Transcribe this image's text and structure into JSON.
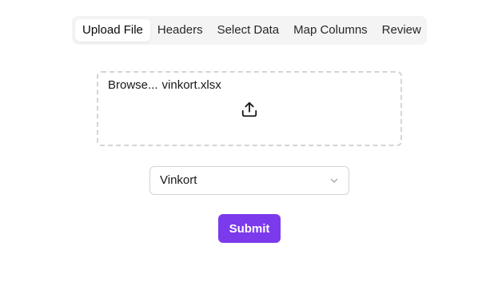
{
  "tabs": [
    {
      "label": "Upload File",
      "active": true
    },
    {
      "label": "Headers",
      "active": false
    },
    {
      "label": "Select Data",
      "active": false
    },
    {
      "label": "Map Columns",
      "active": false
    },
    {
      "label": "Review",
      "active": false
    }
  ],
  "upload": {
    "browse_label": "Browse...",
    "file_name": "vinkort.xlsx",
    "icon": "upload-icon"
  },
  "sheet_select": {
    "selected": "Vinkort",
    "icon": "chevron-down-icon"
  },
  "submit_label": "Submit",
  "colors": {
    "accent": "#7c3aed",
    "tab_bar_bg": "#f4f4f5",
    "border": "#d4d4d8"
  }
}
